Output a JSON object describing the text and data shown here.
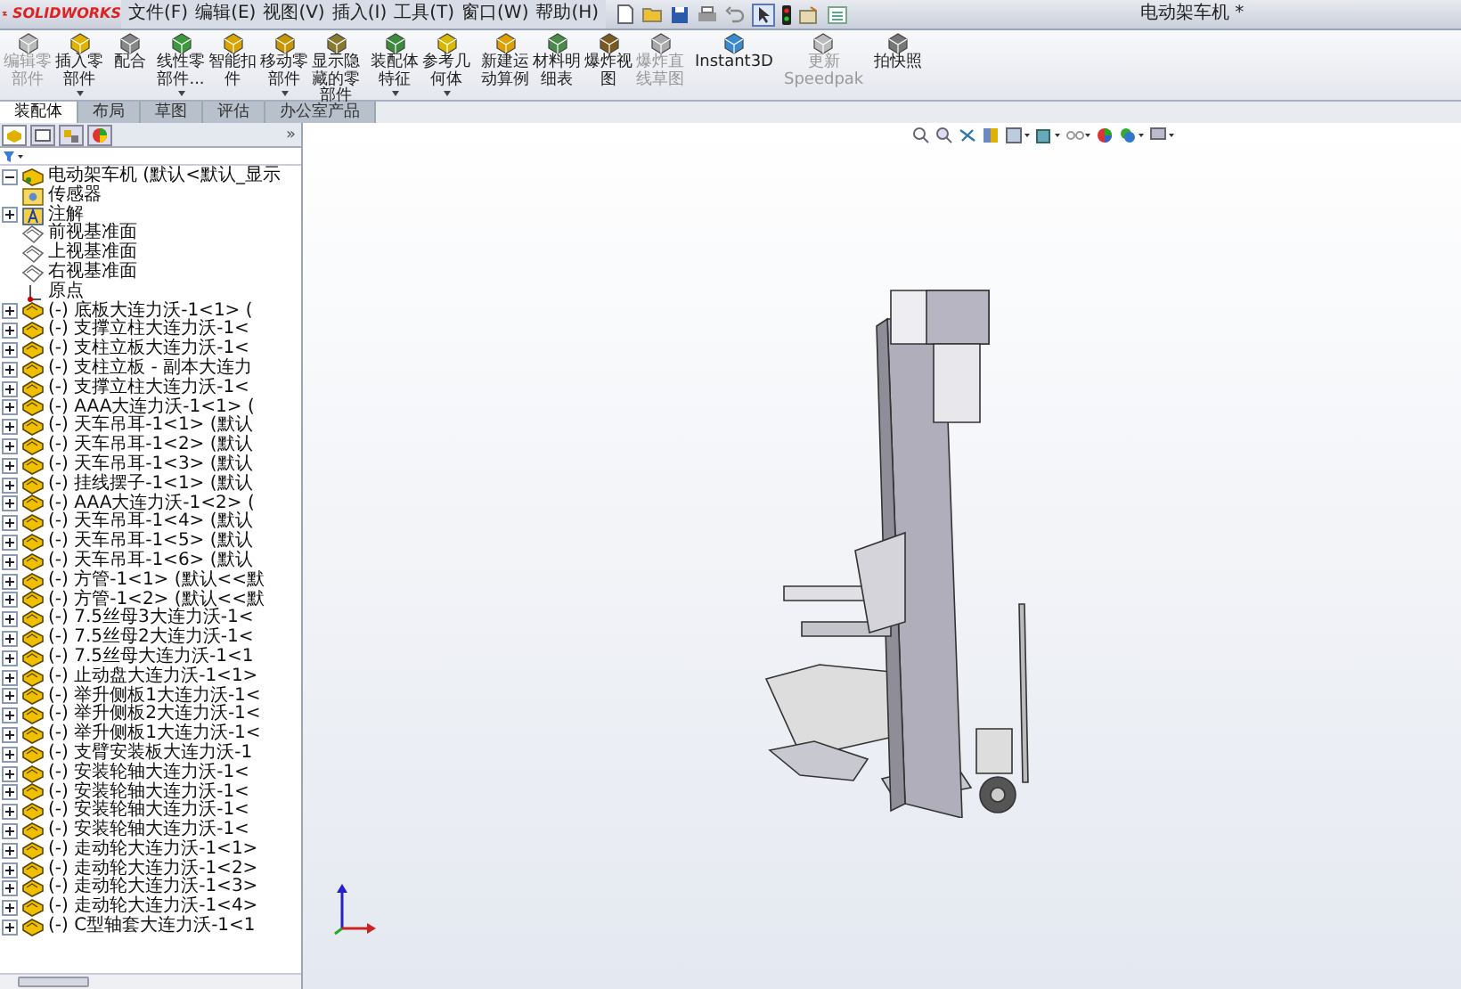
{
  "app": {
    "logo": "SOLIDWORKS",
    "title": "电动架车机 *"
  },
  "menu": [
    "文件(F)",
    "编辑(E)",
    "视图(V)",
    "插入(I)",
    "工具(T)",
    "窗口(W)",
    "帮助(H)"
  ],
  "ribbon": [
    {
      "kind": "edit",
      "lines": [
        "编辑零",
        "部件"
      ],
      "disabled": true,
      "dropdown": false
    },
    {
      "kind": "insert",
      "lines": [
        "插入零",
        "部件"
      ],
      "disabled": false,
      "dropdown": true
    },
    {
      "kind": "mate",
      "lines": [
        "配合"
      ],
      "disabled": false,
      "dropdown": false
    },
    {
      "kind": "pattern",
      "lines": [
        "线性零",
        "部件..."
      ],
      "disabled": false,
      "dropdown": true
    },
    {
      "kind": "fastener",
      "lines": [
        "智能扣",
        "件"
      ],
      "disabled": false,
      "dropdown": false
    },
    {
      "kind": "move",
      "lines": [
        "移动零",
        "部件"
      ],
      "disabled": false,
      "dropdown": true
    },
    {
      "kind": "show",
      "lines": [
        "显示隐",
        "藏的零",
        "部件"
      ],
      "disabled": false,
      "dropdown": false
    },
    {
      "kind": "feature",
      "lines": [
        "装配体",
        "特征"
      ],
      "disabled": false,
      "dropdown": true
    },
    {
      "kind": "geometry",
      "lines": [
        "参考几",
        "何体"
      ],
      "disabled": false,
      "dropdown": true
    },
    {
      "kind": "motion",
      "lines": [
        "新建运",
        "动算例"
      ],
      "disabled": false,
      "dropdown": false
    },
    {
      "kind": "bom",
      "lines": [
        "材料明",
        "细表"
      ],
      "disabled": false,
      "dropdown": false
    },
    {
      "kind": "explode",
      "lines": [
        "爆炸视",
        "图"
      ],
      "disabled": false,
      "dropdown": false
    },
    {
      "kind": "explodeline",
      "lines": [
        "爆炸直",
        "线草图"
      ],
      "disabled": true,
      "dropdown": false
    },
    {
      "kind": "instant",
      "lines": [
        "Instant3D"
      ],
      "disabled": false,
      "dropdown": false
    },
    {
      "kind": "speedpak",
      "lines": [
        "更新",
        "Speedpak"
      ],
      "disabled": true,
      "dropdown": false
    },
    {
      "kind": "snapshot",
      "lines": [
        "拍快照"
      ],
      "disabled": false,
      "dropdown": false
    }
  ],
  "tabs": [
    {
      "label": "装配体",
      "selected": true
    },
    {
      "label": "布局",
      "selected": false
    },
    {
      "label": "草图",
      "selected": false
    },
    {
      "label": "评估",
      "selected": false
    },
    {
      "label": "办公室产品",
      "selected": false
    }
  ],
  "panel": {
    "more": "»"
  },
  "tree": [
    {
      "kind": "assembly",
      "label": "电动架车机 (默认<默认_显示",
      "expanded": true,
      "children": [
        {
          "kind": "sensor",
          "label": "传感器"
        },
        {
          "kind": "annotation",
          "label": "注解",
          "expanded": false
        },
        {
          "kind": "plane",
          "label": "前视基准面"
        },
        {
          "kind": "plane",
          "label": "上视基准面"
        },
        {
          "kind": "plane",
          "label": "右视基准面"
        },
        {
          "kind": "origin",
          "label": "原点"
        },
        {
          "kind": "part",
          "label": "(-) 底板大连力沃-1<1> (",
          "expanded": false
        },
        {
          "kind": "part",
          "label": "(-) 支撑立柱大连力沃-1<",
          "expanded": false
        },
        {
          "kind": "part",
          "label": "(-) 支柱立板大连力沃-1<",
          "expanded": false
        },
        {
          "kind": "part",
          "label": "(-) 支柱立板 - 副本大连力",
          "expanded": false
        },
        {
          "kind": "part",
          "label": "(-) 支撑立柱大连力沃-1<",
          "expanded": false
        },
        {
          "kind": "part",
          "label": "(-) AAA大连力沃-1<1> (",
          "expanded": false
        },
        {
          "kind": "part",
          "label": "(-) 天车吊耳-1<1> (默认",
          "expanded": false
        },
        {
          "kind": "part",
          "label": "(-) 天车吊耳-1<2> (默认",
          "expanded": false
        },
        {
          "kind": "part",
          "label": "(-) 天车吊耳-1<3> (默认",
          "expanded": false
        },
        {
          "kind": "part",
          "label": "(-) 挂线摆子-1<1> (默认",
          "expanded": false
        },
        {
          "kind": "part",
          "label": "(-) AAA大连力沃-1<2> (",
          "expanded": false
        },
        {
          "kind": "part",
          "label": "(-) 天车吊耳-1<4> (默认",
          "expanded": false
        },
        {
          "kind": "part",
          "label": "(-) 天车吊耳-1<5> (默认",
          "expanded": false
        },
        {
          "kind": "part",
          "label": "(-) 天车吊耳-1<6> (默认",
          "expanded": false
        },
        {
          "kind": "part",
          "label": "(-) 方管-1<1> (默认<<默",
          "expanded": false
        },
        {
          "kind": "part",
          "label": "(-) 方管-1<2> (默认<<默",
          "expanded": false
        },
        {
          "kind": "part",
          "label": "(-) 7.5丝母3大连力沃-1<",
          "expanded": false
        },
        {
          "kind": "part",
          "label": "(-) 7.5丝母2大连力沃-1<",
          "expanded": false
        },
        {
          "kind": "part",
          "label": "(-) 7.5丝母大连力沃-1<1",
          "expanded": false
        },
        {
          "kind": "part",
          "label": "(-) 止动盘大连力沃-1<1>",
          "expanded": false
        },
        {
          "kind": "part",
          "label": "(-) 举升侧板1大连力沃-1<",
          "expanded": false
        },
        {
          "kind": "part",
          "label": "(-) 举升侧板2大连力沃-1<",
          "expanded": false
        },
        {
          "kind": "part",
          "label": "(-) 举升侧板1大连力沃-1<",
          "expanded": false
        },
        {
          "kind": "part",
          "label": "(-) 支臂安装板大连力沃-1",
          "expanded": false
        },
        {
          "kind": "part",
          "label": "(-) 安装轮轴大连力沃-1<",
          "expanded": false
        },
        {
          "kind": "part",
          "label": "(-) 安装轮轴大连力沃-1<",
          "expanded": false
        },
        {
          "kind": "part",
          "label": "(-) 安装轮轴大连力沃-1<",
          "expanded": false
        },
        {
          "kind": "part",
          "label": "(-) 安装轮轴大连力沃-1<",
          "expanded": false
        },
        {
          "kind": "part",
          "label": "(-) 走动轮大连力沃-1<1>",
          "expanded": false
        },
        {
          "kind": "part",
          "label": "(-) 走动轮大连力沃-1<2>",
          "expanded": false
        },
        {
          "kind": "part",
          "label": "(-) 走动轮大连力沃-1<3>",
          "expanded": false
        },
        {
          "kind": "part",
          "label": "(-) 走动轮大连力沃-1<4>",
          "expanded": false
        },
        {
          "kind": "part",
          "label": "(-) C型轴套大连力沃-1<1",
          "expanded": false
        }
      ]
    }
  ]
}
